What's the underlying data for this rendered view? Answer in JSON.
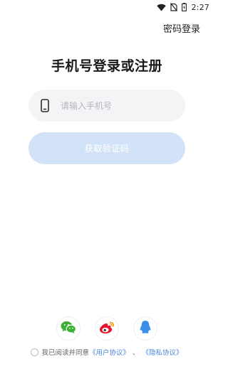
{
  "status_bar": {
    "time": "2:27",
    "icons": [
      "wifi-icon",
      "no-sim-icon",
      "battery-charging-icon"
    ]
  },
  "header": {
    "password_login_label": "密码登录"
  },
  "main": {
    "title": "手机号登录或注册",
    "phone_input": {
      "placeholder": "请输入手机号",
      "value": "",
      "icon": "phone-icon"
    },
    "get_code_button_label": "获取验证码"
  },
  "social_login": {
    "providers": [
      {
        "name": "wechat",
        "icon": "wechat-icon",
        "color": "#3cb035"
      },
      {
        "name": "weibo",
        "icon": "weibo-icon",
        "color": "#e6162d"
      },
      {
        "name": "qq",
        "icon": "qq-icon",
        "color": "#3b8fe8"
      }
    ]
  },
  "agreement": {
    "prefix": "我已阅读并同意",
    "user_agreement": "《用户协议》",
    "separator": "、",
    "privacy_policy": "《隐私协议》",
    "checked": false
  },
  "colors": {
    "accent": "#4a86d8",
    "button_disabled_bg": "#d3e3f7",
    "input_bg": "#f3f4f6"
  }
}
